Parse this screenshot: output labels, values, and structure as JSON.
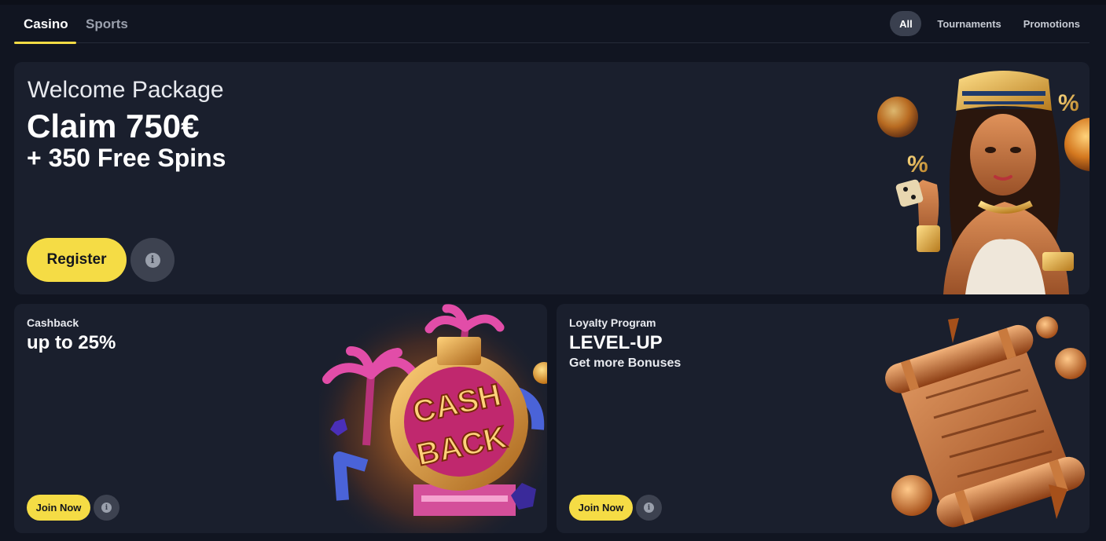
{
  "nav": {
    "tabs": [
      {
        "label": "Casino",
        "active": true
      },
      {
        "label": "Sports",
        "active": false
      }
    ],
    "filters": [
      {
        "label": "All",
        "active": true
      },
      {
        "label": "Tournaments",
        "active": false
      },
      {
        "label": "Promotions",
        "active": false
      }
    ]
  },
  "hero": {
    "subtitle": "Welcome Package",
    "title": "Claim 750€",
    "title2": "+ 350 Free Spins",
    "register_label": "Register",
    "info_icon": "info-icon"
  },
  "cashback": {
    "label": "Cashback",
    "headline": "up to 25%",
    "join_label": "Join Now",
    "art_text_1": "CASH",
    "art_text_2": "BACK"
  },
  "loyalty": {
    "label": "Loyalty Program",
    "headline": "LEVEL-UP",
    "sub": "Get more Bonuses",
    "join_label": "Join Now"
  },
  "colors": {
    "background": "#111521",
    "card": "#1a1f2d",
    "accent": "#f5dc45",
    "info_button": "#3d4250"
  }
}
